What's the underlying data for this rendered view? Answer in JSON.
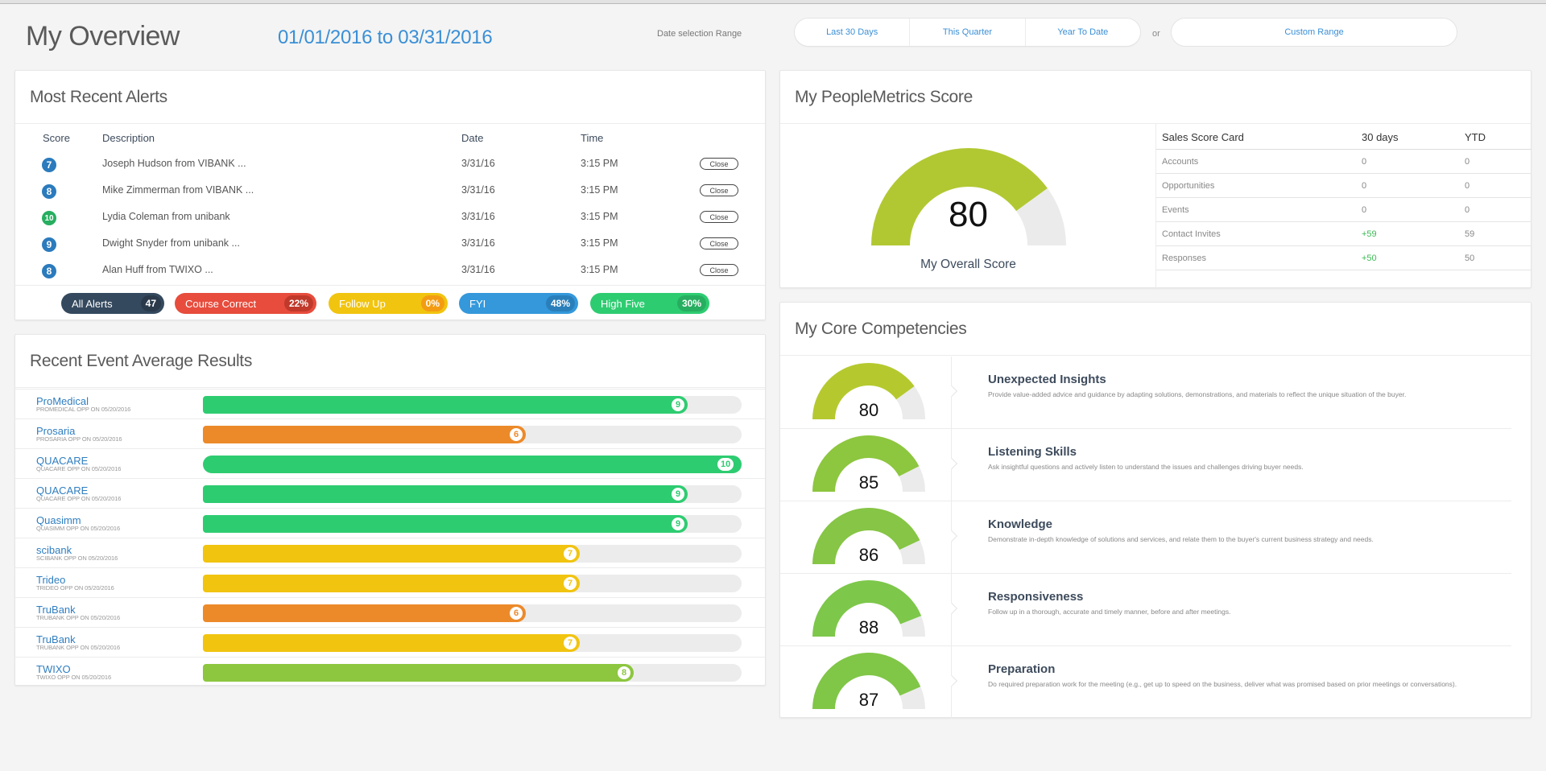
{
  "header": {
    "title": "My Overview",
    "date_range": "01/01/2016 to 03/31/2016",
    "date_selection_label": "Date selection Range",
    "range_buttons": [
      "Last 30 Days",
      "This Quarter",
      "Year To Date"
    ],
    "or_label": "or",
    "custom_range": "Custom Range"
  },
  "alerts": {
    "title": "Most Recent Alerts",
    "columns": {
      "score": "Score",
      "description": "Description",
      "date": "Date",
      "time": "Time"
    },
    "close_label": "Close",
    "rows": [
      {
        "score": "7",
        "score_color": "#2b7bbd",
        "description": "Joseph Hudson from VIBANK ...",
        "date": "3/31/16",
        "time": "3:15 PM"
      },
      {
        "score": "8",
        "score_color": "#2b7bbd",
        "description": "Mike Zimmerman from VIBANK ...",
        "date": "3/31/16",
        "time": "3:15 PM"
      },
      {
        "score": "10",
        "score_color": "#27ae60",
        "description": "Lydia Coleman from unibank",
        "date": "3/31/16",
        "time": "3:15 PM"
      },
      {
        "score": "9",
        "score_color": "#2b7bbd",
        "description": "Dwight Snyder from unibank ...",
        "date": "3/31/16",
        "time": "3:15 PM"
      },
      {
        "score": "8",
        "score_color": "#2b7bbd",
        "description": "Alan Huff from TWIXO ...",
        "date": "3/31/16",
        "time": "3:15 PM"
      }
    ],
    "filters": [
      {
        "label": "All Alerts",
        "value": "47",
        "color": "#34495e",
        "badge_color": "#2a3a4b"
      },
      {
        "label": "Course Correct",
        "value": "22%",
        "color": "#e74c3c",
        "badge_color": "#c0392b"
      },
      {
        "label": "Follow Up",
        "value": "0%",
        "color": "#f1c40f",
        "badge_color": "#f39c12"
      },
      {
        "label": "FYI",
        "value": "48%",
        "color": "#3498db",
        "badge_color": "#2a7fba"
      },
      {
        "label": "High Five",
        "value": "30%",
        "color": "#2ecc71",
        "badge_color": "#27ae60"
      }
    ]
  },
  "events": {
    "title": "Recent Event Average Results",
    "max_score": 10,
    "rows": [
      {
        "name": "ProMedical",
        "subtitle": "PROMEDICAL OPP ON 05/20/2016",
        "score": 9,
        "color": "#2ecc71"
      },
      {
        "name": "Prosaria",
        "subtitle": "PROSARIA OPP ON 05/20/2016",
        "score": 6,
        "color": "#ec8a2a"
      },
      {
        "name": "QUACARE",
        "subtitle": "QUACARE OPP ON 05/20/2016",
        "score": 10,
        "color": "#2ecc71"
      },
      {
        "name": "QUACARE",
        "subtitle": "QUACARE OPP ON 05/20/2016",
        "score": 9,
        "color": "#2ecc71"
      },
      {
        "name": "Quasimm",
        "subtitle": "QUASIMM OPP ON 05/20/2016",
        "score": 9,
        "color": "#2ecc71"
      },
      {
        "name": "scibank",
        "subtitle": "SCIBANK OPP ON 05/20/2016",
        "score": 7,
        "color": "#f1c40f"
      },
      {
        "name": "Trideo",
        "subtitle": "TRIDEO OPP ON 05/20/2016",
        "score": 7,
        "color": "#f1c40f"
      },
      {
        "name": "TruBank",
        "subtitle": "TRUBANK OPP ON 05/20/2016",
        "score": 6,
        "color": "#ec8a2a"
      },
      {
        "name": "TruBank",
        "subtitle": "TRUBANK OPP ON 05/20/2016",
        "score": 7,
        "color": "#f1c40f"
      },
      {
        "name": "TWIXO",
        "subtitle": "TWIXO OPP ON 05/20/2016",
        "score": 8,
        "color": "#8dc63f"
      }
    ]
  },
  "peoplemetrics": {
    "title": "My PeopleMetrics Score",
    "overall_score": 80,
    "overall_max": 100,
    "overall_color": "#b2c832",
    "track_color": "#ebebeb",
    "overall_caption": "My Overall Score",
    "scorecard": {
      "headers": [
        "Sales Score Card",
        "30 days",
        "YTD"
      ],
      "rows": [
        {
          "label": "Accounts",
          "d30": "0",
          "ytd": "0",
          "positive": false
        },
        {
          "label": "Opportunities",
          "d30": "0",
          "ytd": "0",
          "positive": false
        },
        {
          "label": "Events",
          "d30": "0",
          "ytd": "0",
          "positive": false
        },
        {
          "label": "Contact Invites",
          "d30": "+59",
          "ytd": "59",
          "positive": true
        },
        {
          "label": "Responses",
          "d30": "+50",
          "ytd": "50",
          "positive": true
        }
      ]
    }
  },
  "competencies": {
    "title": "My Core Competencies",
    "track_color": "#ebebeb",
    "items": [
      {
        "score": 80,
        "color": "#b5c92f",
        "title": "Unexpected Insights",
        "description": "Provide value-added advice and guidance by adapting solutions, demonstrations, and materials to reflect the unique situation of the buyer."
      },
      {
        "score": 85,
        "color": "#8dc63f",
        "title": "Listening Skills",
        "description": "Ask insightful questions and actively listen to understand the issues and challenges driving buyer needs."
      },
      {
        "score": 86,
        "color": "#86c545",
        "title": "Knowledge",
        "description": "Demonstrate in-depth knowledge of solutions and services, and relate them to the buyer's current business strategy and needs."
      },
      {
        "score": 88,
        "color": "#7dc74a",
        "title": "Responsiveness",
        "description": "Follow up in a thorough, accurate and timely manner, before and after meetings."
      },
      {
        "score": 87,
        "color": "#80c647",
        "title": "Preparation",
        "description": "Do required preparation work for the meeting (e.g., get up to speed on the business, deliver what was promised based on prior meetings or conversations)."
      }
    ]
  }
}
